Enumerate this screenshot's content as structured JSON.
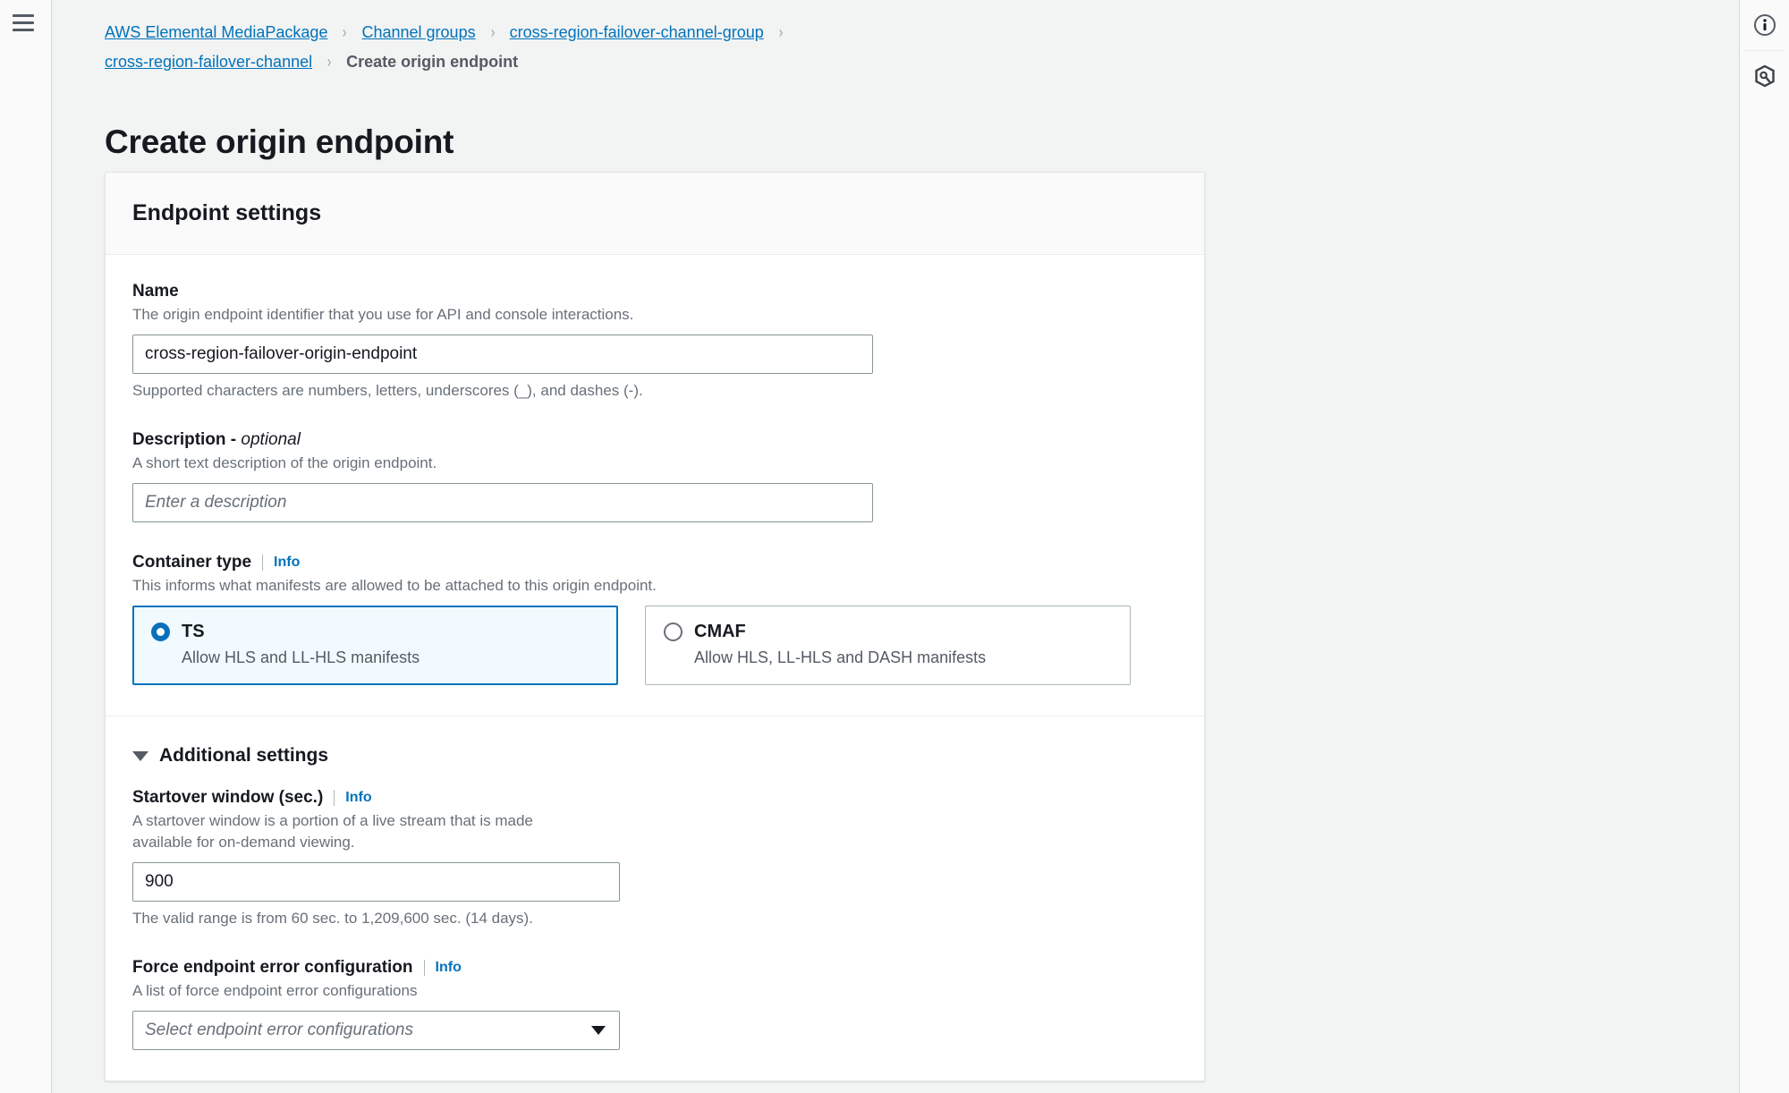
{
  "nav": {
    "menu_icon": "hamburger-menu-icon",
    "right_tools": [
      {
        "icon": "info-circle-icon",
        "name": "info-panel-toggle"
      },
      {
        "icon": "settings-hex-icon",
        "name": "settings-panel-toggle"
      }
    ]
  },
  "breadcrumb": {
    "items": [
      {
        "label": "AWS Elemental MediaPackage",
        "link": true
      },
      {
        "label": "Channel groups",
        "link": true
      },
      {
        "label": "cross-region-failover-channel-group",
        "link": true
      },
      {
        "label": "cross-region-failover-channel",
        "link": true
      },
      {
        "label": "Create origin endpoint",
        "link": false
      }
    ],
    "separator": "›"
  },
  "page": {
    "title": "Create origin endpoint"
  },
  "card": {
    "header": "Endpoint settings",
    "name_field": {
      "label": "Name",
      "description": "The origin endpoint identifier that you use for API and console interactions.",
      "value": "cross-region-failover-origin-endpoint",
      "hint": "Supported characters are numbers, letters, underscores (_), and dashes (-)."
    },
    "description_field": {
      "label": "Description -",
      "label_optional": "optional",
      "description": "A short text description of the origin endpoint.",
      "placeholder": "Enter a description",
      "value": ""
    },
    "container_type": {
      "label": "Container type",
      "info": "Info",
      "description": "This informs what manifests are allowed to be attached to this origin endpoint.",
      "options": [
        {
          "title": "TS",
          "subtitle": "Allow HLS and LL-HLS manifests",
          "selected": true
        },
        {
          "title": "CMAF",
          "subtitle": "Allow HLS, LL-HLS and DASH manifests",
          "selected": false
        }
      ]
    },
    "additional_settings": {
      "label": "Additional settings",
      "expanded": true,
      "startover_window": {
        "label": "Startover window (sec.)",
        "info": "Info",
        "description": "A startover window is a portion of a live stream that is made available for on-demand viewing.",
        "value": "900",
        "hint": "The valid range is from 60 sec. to 1,209,600 sec. (14 days)."
      },
      "force_endpoint_error": {
        "label": "Force endpoint error configuration",
        "info": "Info",
        "description": "A list of force endpoint error configurations",
        "placeholder": "Select endpoint error configurations",
        "value": ""
      }
    }
  },
  "colors": {
    "link": "#0073bb",
    "selected_border": "#0073bb",
    "selected_bg": "#f1faff",
    "page_bg": "#f2f3f3",
    "text": "#16191f",
    "muted": "#687078"
  }
}
